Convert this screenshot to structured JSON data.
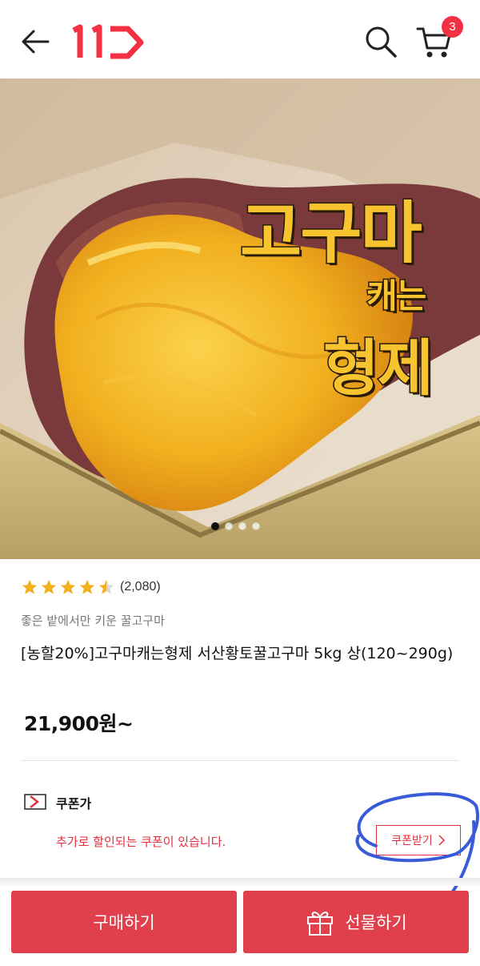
{
  "header": {
    "logo": "11",
    "cart_count": "3",
    "icons": [
      "back-arrow-icon",
      "logo-11st",
      "search-icon",
      "cart-icon"
    ],
    "brand_color": "#f43142"
  },
  "hero": {
    "title_line1": "고구마",
    "title_line2": "캐는",
    "title_line3": "형제",
    "slide_index": 1,
    "slide_total": 4
  },
  "product": {
    "rating": 4.5,
    "rating_count": "(2,080)",
    "subtitle": "좋은 밭에서만 키운 꿀고구마",
    "title": "[농할20%]고구마캐는형제 서산황토꿀고구마 5kg 상(120~290g)",
    "price": "21,900원~"
  },
  "coupon": {
    "label": "쿠폰가",
    "message": "추가로 할인되는 쿠폰이 있습니다.",
    "button": "쿠폰받기",
    "accent": "#e2323f"
  },
  "actions": {
    "buy": "구매하기",
    "gift": "선물하기",
    "button_color": "#e0404c"
  },
  "annotation_color": "#3a5bd9"
}
